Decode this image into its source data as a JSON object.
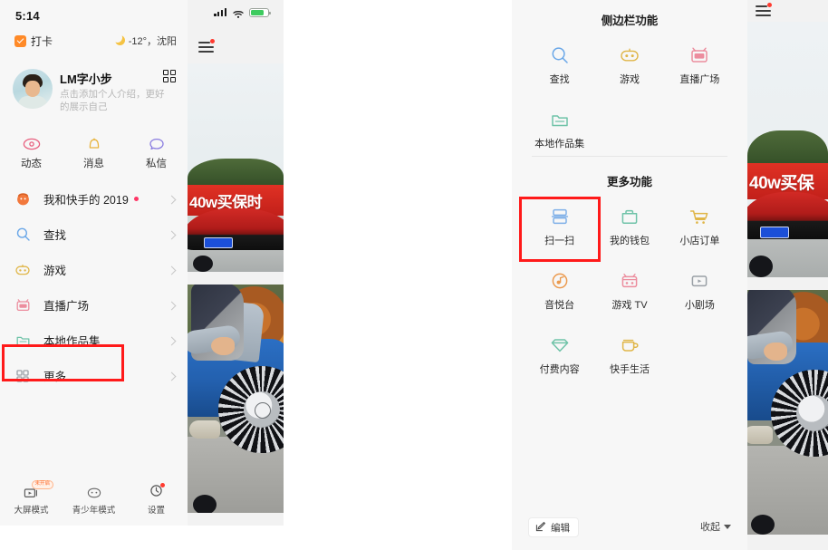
{
  "left_phone": {
    "status_bar": {
      "time": "5:14"
    },
    "check_in": {
      "label": "打卡",
      "icon": "checkbox-checked-icon"
    },
    "weather": {
      "icon": "moon-icon",
      "text": "-12°，沈阳"
    },
    "profile": {
      "nickname": "LM字小步",
      "bio": "点击添加个人介绍，更好的展示自己",
      "qr_icon": "qr-code-icon",
      "avatar": "user-avatar"
    },
    "quick_actions": [
      {
        "label": "动态",
        "icon": "eye-icon",
        "color": "#e8607f"
      },
      {
        "label": "消息",
        "icon": "bell-icon",
        "color": "#e8b33c"
      },
      {
        "label": "私信",
        "icon": "chat-bubble-icon",
        "color": "#8a7de0"
      }
    ],
    "menu_items": [
      {
        "label": "我和快手的 2019",
        "icon": "calendar-face-icon",
        "color": "#f2783c",
        "dot": true
      },
      {
        "label": "查找",
        "icon": "search-icon",
        "color": "#6aa7e8",
        "dot": false
      },
      {
        "label": "游戏",
        "icon": "game-robot-icon",
        "color": "#e0b648",
        "dot": false
      },
      {
        "label": "直播广场",
        "icon": "live-tv-icon",
        "color": "#ec8d9e",
        "dot": false
      },
      {
        "label": "本地作品集",
        "icon": "folder-icon",
        "color": "#6fc3a8",
        "dot": false
      },
      {
        "label": "更多",
        "icon": "grid-more-icon",
        "color": "#9aa0a6",
        "dot": false
      }
    ],
    "bottom_bar": [
      {
        "label": "大屏模式",
        "icon": "big-screen-icon",
        "badge": "未开启",
        "dot": false
      },
      {
        "label": "青少年模式",
        "icon": "teen-mode-icon",
        "badge": "",
        "dot": false
      },
      {
        "label": "设置",
        "icon": "settings-icon",
        "badge": "",
        "dot": true
      }
    ],
    "video_preview": {
      "banner_text": "40w买保时",
      "hamburger": "hamburger-menu-icon",
      "signal": "signal-bars-icon",
      "wifi": "wifi-icon",
      "battery": "battery-icon"
    },
    "highlight": {
      "target": "更多",
      "color": "#ff1a1a"
    }
  },
  "right_phone": {
    "sections": [
      {
        "title": "侧边栏功能",
        "items": [
          {
            "label": "查找",
            "icon": "search-icon",
            "color": "#6aa7e8"
          },
          {
            "label": "游戏",
            "icon": "game-robot-icon",
            "color": "#e0b648"
          },
          {
            "label": "直播广场",
            "icon": "live-tv-icon",
            "color": "#ec8d9e"
          },
          {
            "label": "本地作品集",
            "icon": "folder-icon",
            "color": "#6fc3a8"
          }
        ]
      },
      {
        "title": "更多功能",
        "items": [
          {
            "label": "扫一扫",
            "icon": "scan-icon",
            "color": "#7fb0e8"
          },
          {
            "label": "我的钱包",
            "icon": "wallet-icon",
            "color": "#6fc3a8"
          },
          {
            "label": "小店订单",
            "icon": "shopping-cart-icon",
            "color": "#e0b648"
          },
          {
            "label": "音悦台",
            "icon": "music-disc-icon",
            "color": "#eb9a4e"
          },
          {
            "label": "游戏 TV",
            "icon": "game-tv-icon",
            "color": "#ec8d9e"
          },
          {
            "label": "小剧场",
            "icon": "theater-screen-icon",
            "color": "#9aa0a6"
          },
          {
            "label": "付费内容",
            "icon": "diamond-icon",
            "color": "#6fc3a8"
          },
          {
            "label": "快手生活",
            "icon": "cup-icon",
            "color": "#e0b648"
          }
        ]
      }
    ],
    "bottom_bar": {
      "edit_label": "编辑",
      "edit_icon": "edit-pencil-icon",
      "collapse_label": "收起",
      "collapse_icon": "caret-down-icon"
    },
    "video_preview": {
      "banner_text": "40w买保",
      "hamburger": "hamburger-menu-icon"
    },
    "highlight": {
      "target": "扫一扫",
      "color": "#ff1a1a"
    }
  }
}
